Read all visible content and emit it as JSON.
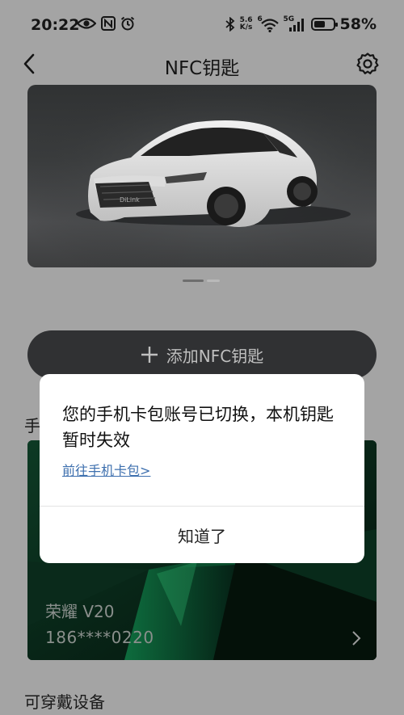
{
  "status_bar": {
    "time": "20:22",
    "network_speed_top": "5.6",
    "network_speed_unit": "K/s",
    "wifi_badge": "6",
    "signal_badge": "5G",
    "battery_percent": "58%",
    "battery_level": 0.58
  },
  "nav": {
    "title": "NFC钥匙"
  },
  "car_carousel": {
    "car_badge": "DiLink",
    "page_count": 2,
    "current_page": 1
  },
  "add_button": {
    "label": "添加NFC钥匙"
  },
  "phone_section": {
    "label_visible": "手"
  },
  "phone_card": {
    "model": "荣耀 V20",
    "number": "186****0220"
  },
  "wearable_section": {
    "label": "可穿戴设备"
  },
  "dialog": {
    "message": "您的手机卡包账号已切换，本机钥匙暂时失效",
    "link": "前往手机卡包>",
    "confirm": "知道了"
  },
  "colors": {
    "overlay_bg": "#a4a4a4",
    "button_dark": "#303133",
    "link_blue": "#3d6fae",
    "card_green": "#0b5a35"
  }
}
